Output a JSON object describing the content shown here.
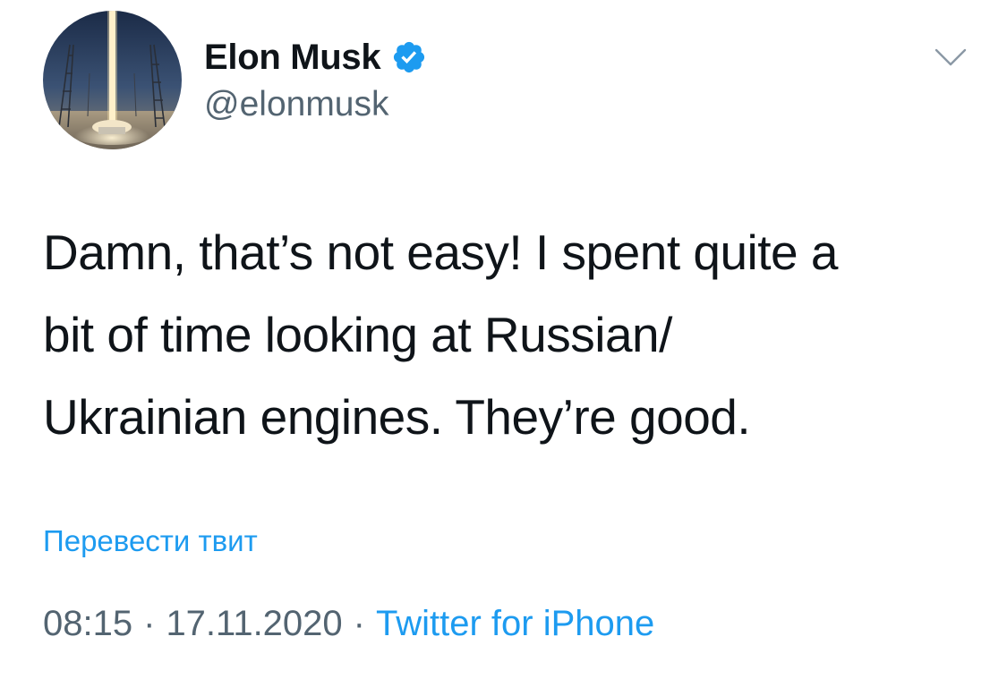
{
  "tweet": {
    "author": {
      "display_name": "Elon Musk",
      "handle": "@elonmusk",
      "verified": true,
      "avatar_icon": "rocket-launch-avatar"
    },
    "menu_icon": "chevron-down-icon",
    "text_lines": [
      "Damn, that’s not easy! I spent quite a",
      "bit of time looking at Russian/",
      "Ukrainian engines. They’re good."
    ],
    "translate_label": "Перевести твит",
    "time": "08:15",
    "date": "17.11.2020",
    "separator": "·",
    "source": "Twitter for iPhone"
  },
  "colors": {
    "accent": "#1d9bf0",
    "text": "#0f1419",
    "secondary": "#536471"
  }
}
